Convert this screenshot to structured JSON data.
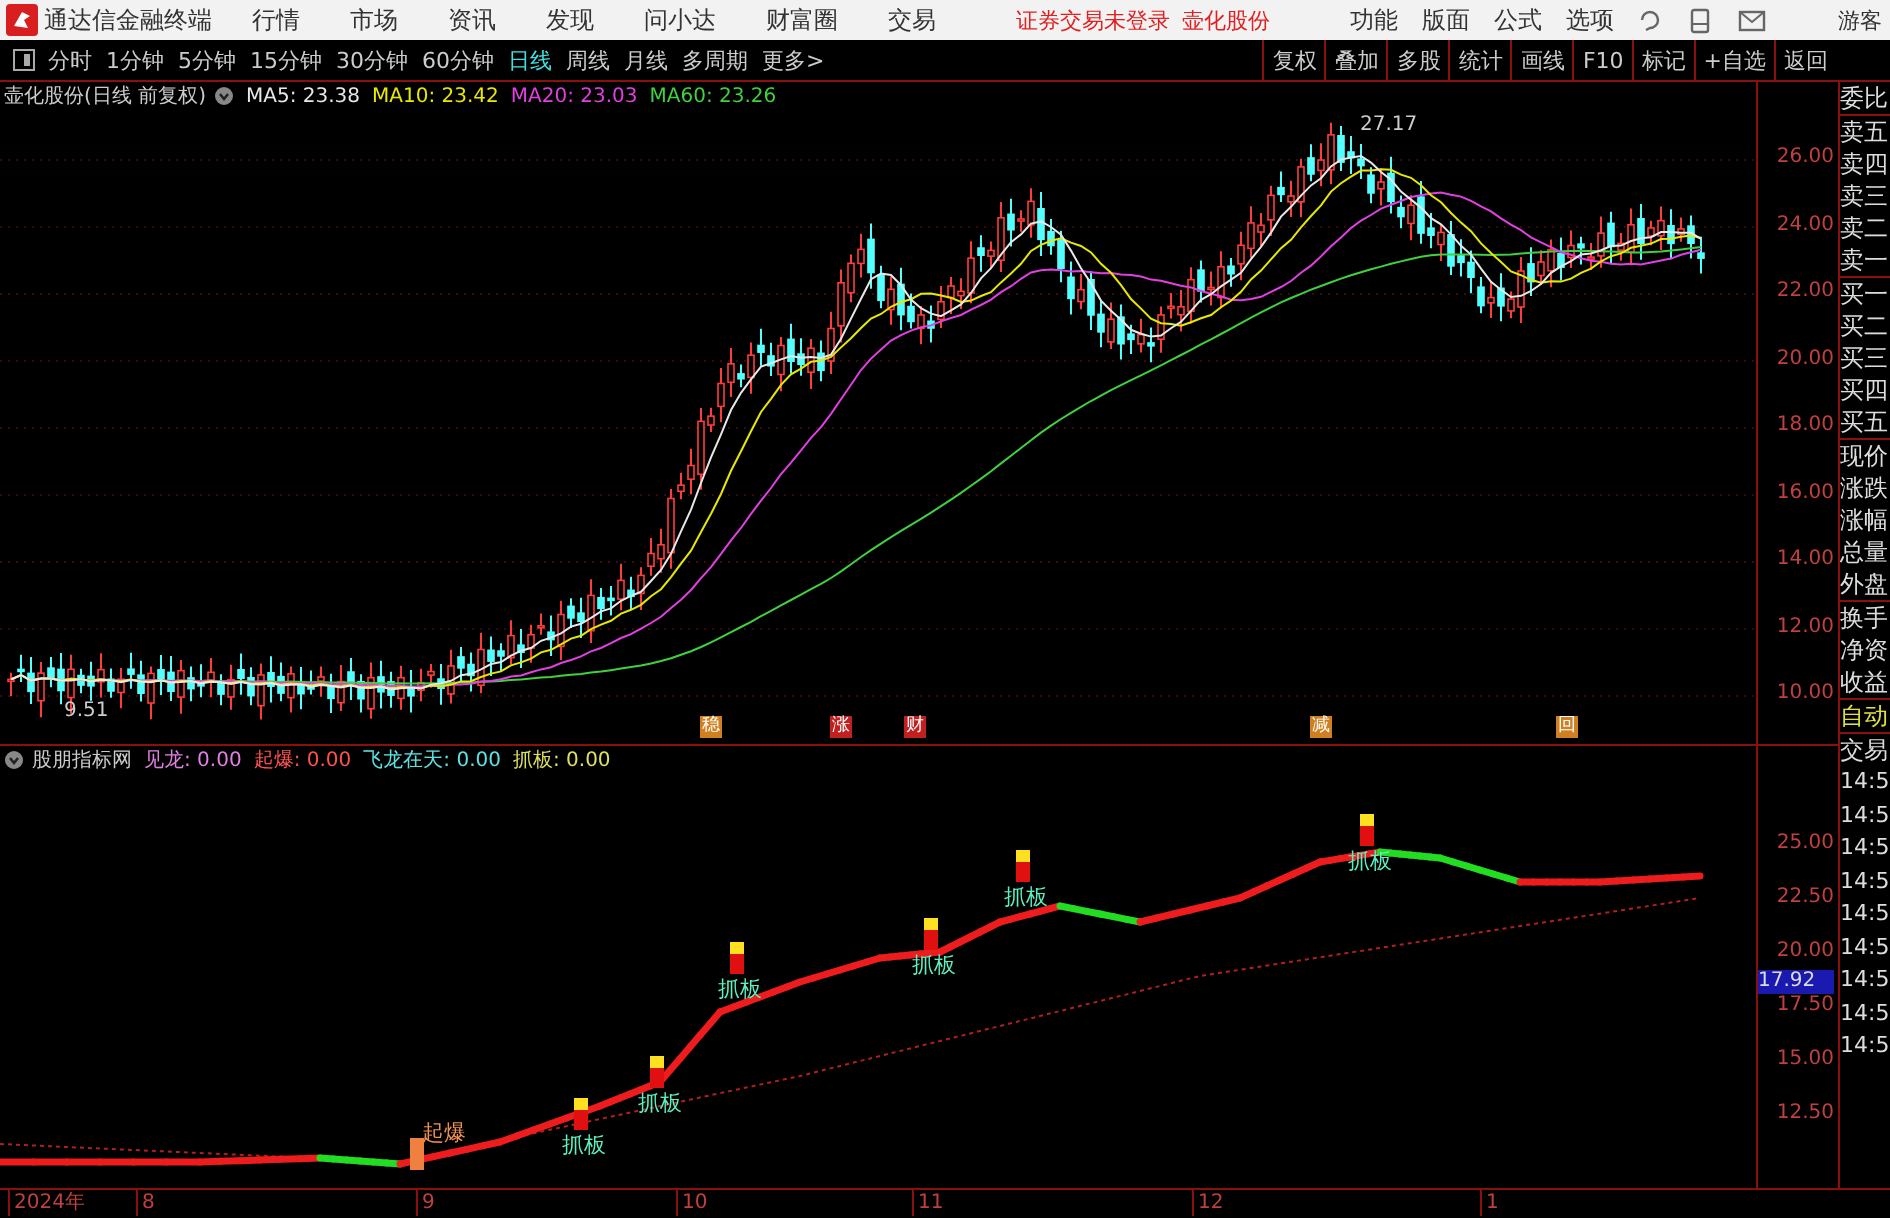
{
  "app": {
    "title": "通达信金融终端",
    "menu": [
      "行情",
      "市场",
      "资讯",
      "发现",
      "问小达",
      "财富圈",
      "交易"
    ],
    "status": [
      "证券交易未登录",
      "壶化股份"
    ],
    "menu_right": [
      "功能",
      "版面",
      "公式",
      "选项"
    ],
    "user": "游客"
  },
  "periods": [
    {
      "label": "分时",
      "selected": false
    },
    {
      "label": "1分钟",
      "selected": false
    },
    {
      "label": "5分钟",
      "selected": false
    },
    {
      "label": "15分钟",
      "selected": false
    },
    {
      "label": "30分钟",
      "selected": false
    },
    {
      "label": "60分钟",
      "selected": false
    },
    {
      "label": "日线",
      "selected": true
    },
    {
      "label": "周线",
      "selected": false
    },
    {
      "label": "月线",
      "selected": false
    },
    {
      "label": "多周期",
      "selected": false
    },
    {
      "label": "更多>",
      "selected": false
    }
  ],
  "tools": [
    "复权",
    "叠加",
    "多股",
    "统计",
    "画线",
    "F10",
    "标记",
    "+自选",
    "返回"
  ],
  "price_chart": {
    "title": "壶化股份(日线 前复权)",
    "ma": [
      {
        "label": "MA5: 23.38",
        "color": "#e8e8e8"
      },
      {
        "label": "MA10: 23.42",
        "color": "#e8e800"
      },
      {
        "label": "MA20: 23.03",
        "color": "#e040e0"
      },
      {
        "label": "MA60: 23.26",
        "color": "#40d040"
      }
    ],
    "high_label": "27.17",
    "low_label": "9.51",
    "yticks": [
      "26.00",
      "24.00",
      "22.00",
      "20.00",
      "18.00",
      "16.00",
      "14.00",
      "12.00",
      "10.00"
    ],
    "markers": [
      {
        "label": "稳",
        "color": "#d08020"
      },
      {
        "label": "涨",
        "color": "#c02020"
      },
      {
        "label": "财",
        "color": "#c02020"
      },
      {
        "label": "减",
        "color": "#d08020"
      },
      {
        "label": "回",
        "color": "#d08020"
      }
    ]
  },
  "indicator": {
    "title": "股朋指标网",
    "values": [
      {
        "label": "见龙: 0.00",
        "color": "#e080e0"
      },
      {
        "label": "起爆: 0.00",
        "color": "#ff5050"
      },
      {
        "label": "飞龙在天: 0.00",
        "color": "#60e0e0"
      },
      {
        "label": "抓板: 0.00",
        "color": "#e0e060"
      }
    ],
    "signals": [
      {
        "label": "起爆"
      },
      {
        "label": "抓板"
      },
      {
        "label": "抓板"
      },
      {
        "label": "抓板"
      },
      {
        "label": "抓板"
      },
      {
        "label": "抓板"
      },
      {
        "label": "抓板"
      }
    ],
    "yticks": [
      "25.00",
      "22.50",
      "20.00",
      "17.50",
      "15.00",
      "12.50"
    ],
    "current": "17.92"
  },
  "dates": [
    "2024年",
    "8",
    "9",
    "10",
    "11",
    "12",
    "1"
  ],
  "quote_panel": {
    "groups": [
      [
        "委比"
      ],
      [
        "卖五",
        "卖四",
        "卖三",
        "卖二",
        "卖一"
      ],
      [
        "买一",
        "买二",
        "买三",
        "买四",
        "买五"
      ],
      [
        "现价",
        "涨跌",
        "涨幅",
        "总量",
        "外盘"
      ],
      [
        "换手",
        "净资",
        "收益"
      ]
    ],
    "auto": "自动",
    "trade": "交易",
    "times": [
      "14:5",
      "14:5",
      "14:5",
      "14:5",
      "14:5",
      "14:5",
      "14:5",
      "14:5",
      "14:5"
    ]
  }
}
